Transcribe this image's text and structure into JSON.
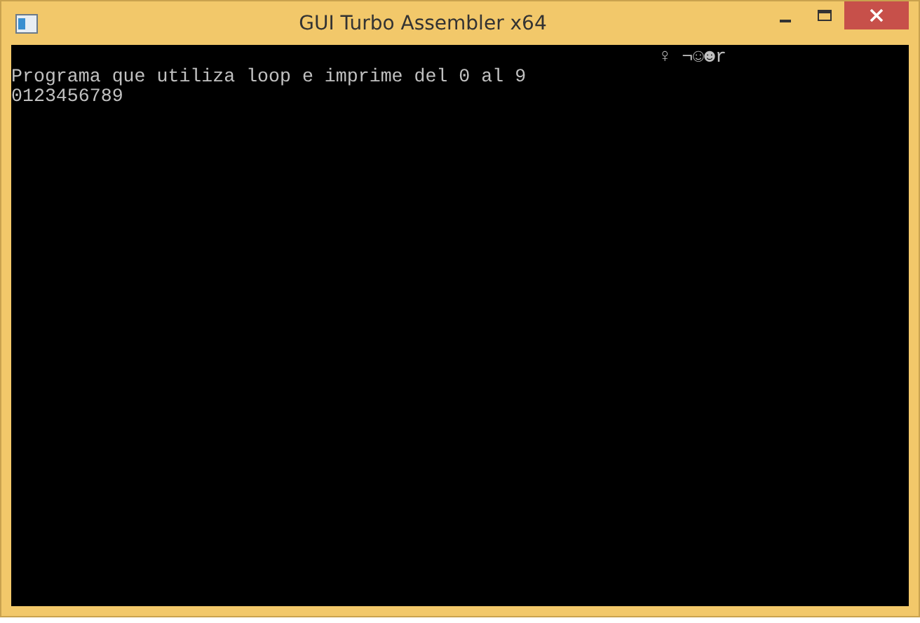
{
  "window": {
    "title": "GUI Turbo Assembler x64"
  },
  "console": {
    "lines": [
      "♀ ¬☺☻r",
      "Programa que utiliza loop e imprime del 0 al 9",
      "0123456789"
    ]
  }
}
